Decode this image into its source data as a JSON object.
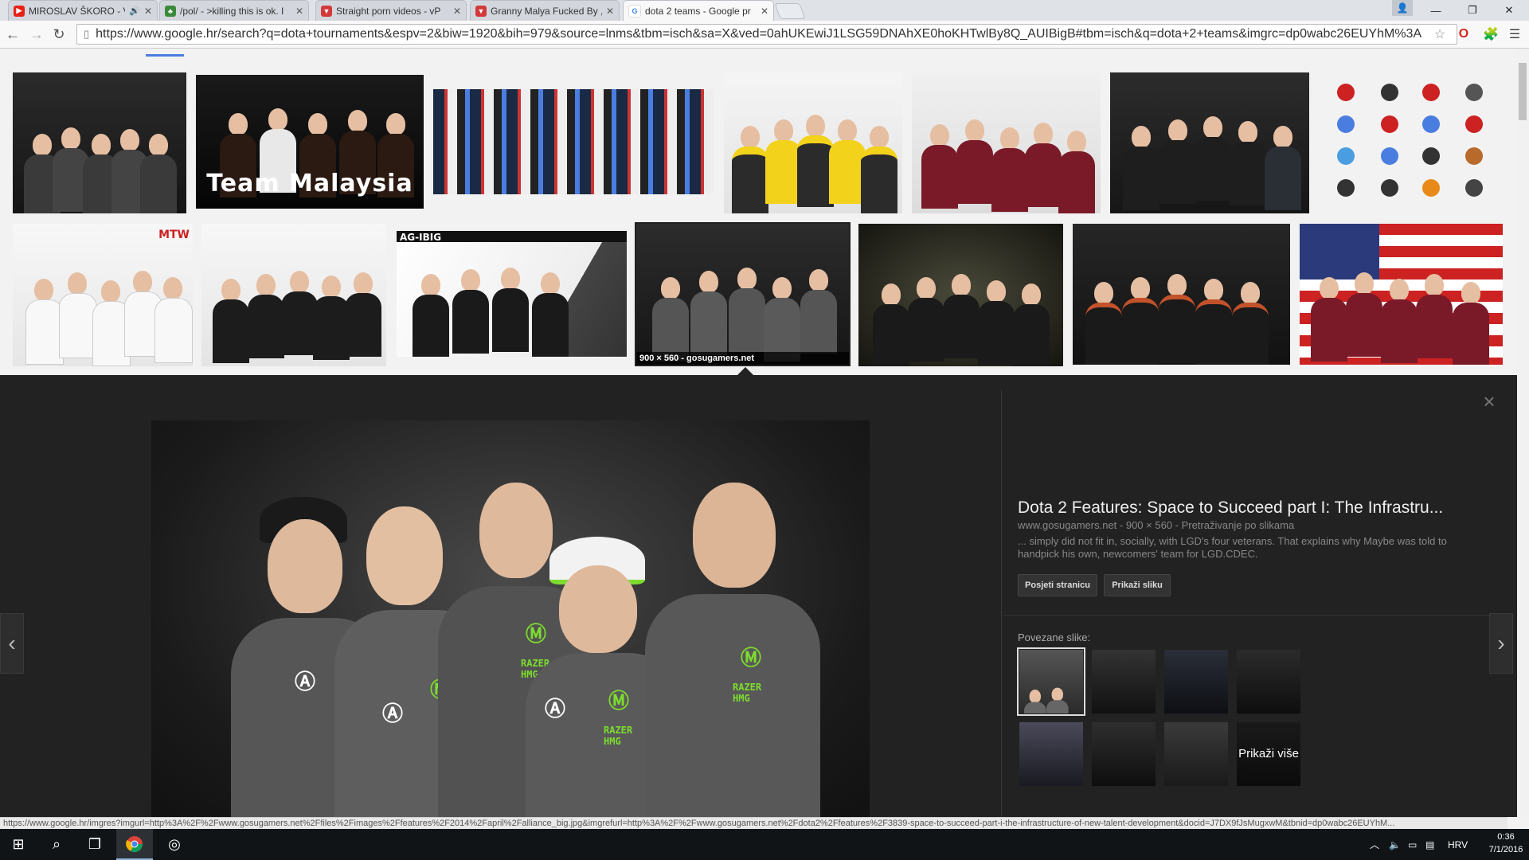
{
  "browser": {
    "tabs": [
      {
        "title": "MIROSLAV ŠKORO - V",
        "favicon": "youtube-icon",
        "audio": true
      },
      {
        "title": "/pol/ - >killing this is ok. I",
        "favicon": "clover-icon"
      },
      {
        "title": "Straight porn videos - vP",
        "favicon": "vporn-icon"
      },
      {
        "title": "Granny Malya Fucked By ,",
        "favicon": "vporn-icon"
      },
      {
        "title": "dota 2 teams - Google pr",
        "favicon": "google-icon",
        "active": true
      }
    ],
    "url": "https://www.google.hr/search?q=dota+tournaments&espv=2&biw=1920&bih=979&source=lnms&tbm=isch&sa=X&ved=0ahUKEwiJ1LSG59DNAhXE0hoKHTwlBy8Q_AUIBigB#tbm=isch&q=dota+2+teams&imgrc=dp0wabc26EUYhM%3A",
    "status_url": "https://www.google.hr/imgres?imgurl=http%3A%2F%2Fwww.gosugamers.net%2Ffiles%2Fimages%2Ffeatures%2F2014%2Fapril%2Falliance_big.jpg&imgrefurl=http%3A%2F%2Fwww.gosugamers.net%2Fdota2%2Ffeatures%2F3839-space-to-succeed-part-i-the-infrastructure-of-new-talent-development&docid=J7DX9fJsMugxwM&tbnid=dp0wabc26EUYhM..."
  },
  "grid": {
    "row1_labels": {
      "team_malaysia": "Team Malaysia"
    },
    "row2_labels": {
      "mtw": "MTW",
      "ag_ibig": "AG-IBIG"
    },
    "selected_caption": "900 × 560 - gosugamers.net"
  },
  "preview": {
    "title": "Dota 2 Features: Space to Succeed part I: The Infrastru...",
    "meta": "www.gosugamers.net - 900 × 560 - Pretraživanje po slikama",
    "description": "... simply did not fit in, socially, with LGD's four veterans. That explains why Maybe was told to handpick his own, newcomers' team for LGD.CDEC.",
    "visit_button": "Posjeti stranicu",
    "view_button": "Prikaži sliku",
    "related_label": "Povezane slike:",
    "more_label": "Prikaži više"
  },
  "taskbar": {
    "language": "HRV",
    "time": "0:36",
    "date": "7/1/2016"
  },
  "colors": {
    "accent_blue": "#4a7de0",
    "panel_bg": "#222222",
    "monster_green": "#7ddc2f"
  }
}
